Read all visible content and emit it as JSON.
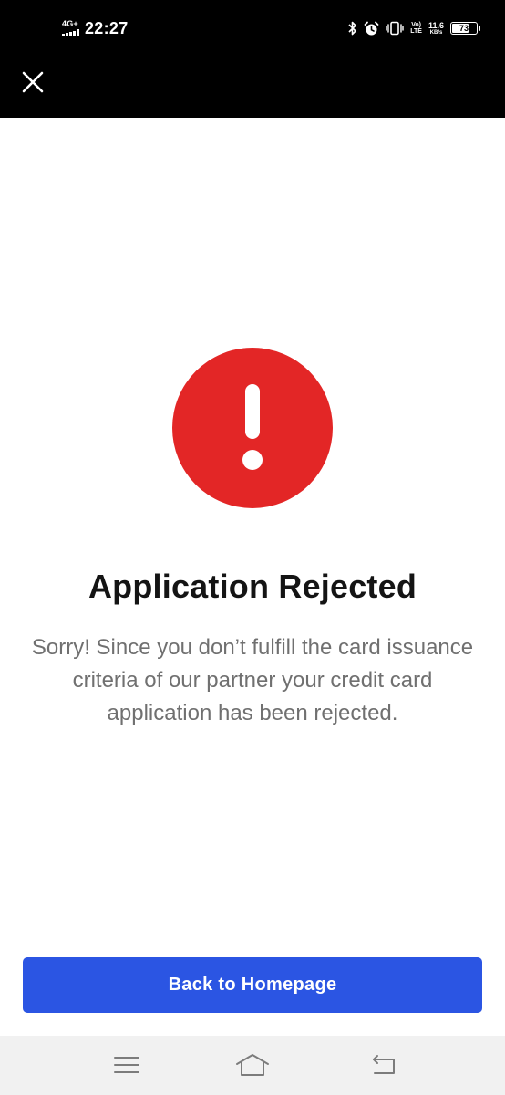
{
  "status_bar": {
    "network_type": "4G+",
    "time": "22:27",
    "lte_top": "Vo)",
    "lte_bottom": "LTE",
    "net_speed_value": "11.6",
    "net_speed_unit": "KB/s",
    "battery_level": "73",
    "battery_fraction": 0.73,
    "icons": [
      "bluetooth-icon",
      "alarm-icon",
      "vibrate-icon",
      "volte-icon",
      "battery-icon"
    ]
  },
  "app_bar": {
    "close_icon": "close-icon"
  },
  "main": {
    "alert_icon": "exclamation-icon",
    "alert_color": "#e32626",
    "title": "Application Rejected",
    "message": "Sorry! Since you don’t fulfill the card issuance criteria of our partner your credit card application has been rejected."
  },
  "actions": {
    "primary_label": "Back to Homepage",
    "primary_color": "#2b55e3"
  },
  "nav_bar": {
    "items": [
      "menu-icon",
      "home-icon",
      "back-icon"
    ]
  }
}
